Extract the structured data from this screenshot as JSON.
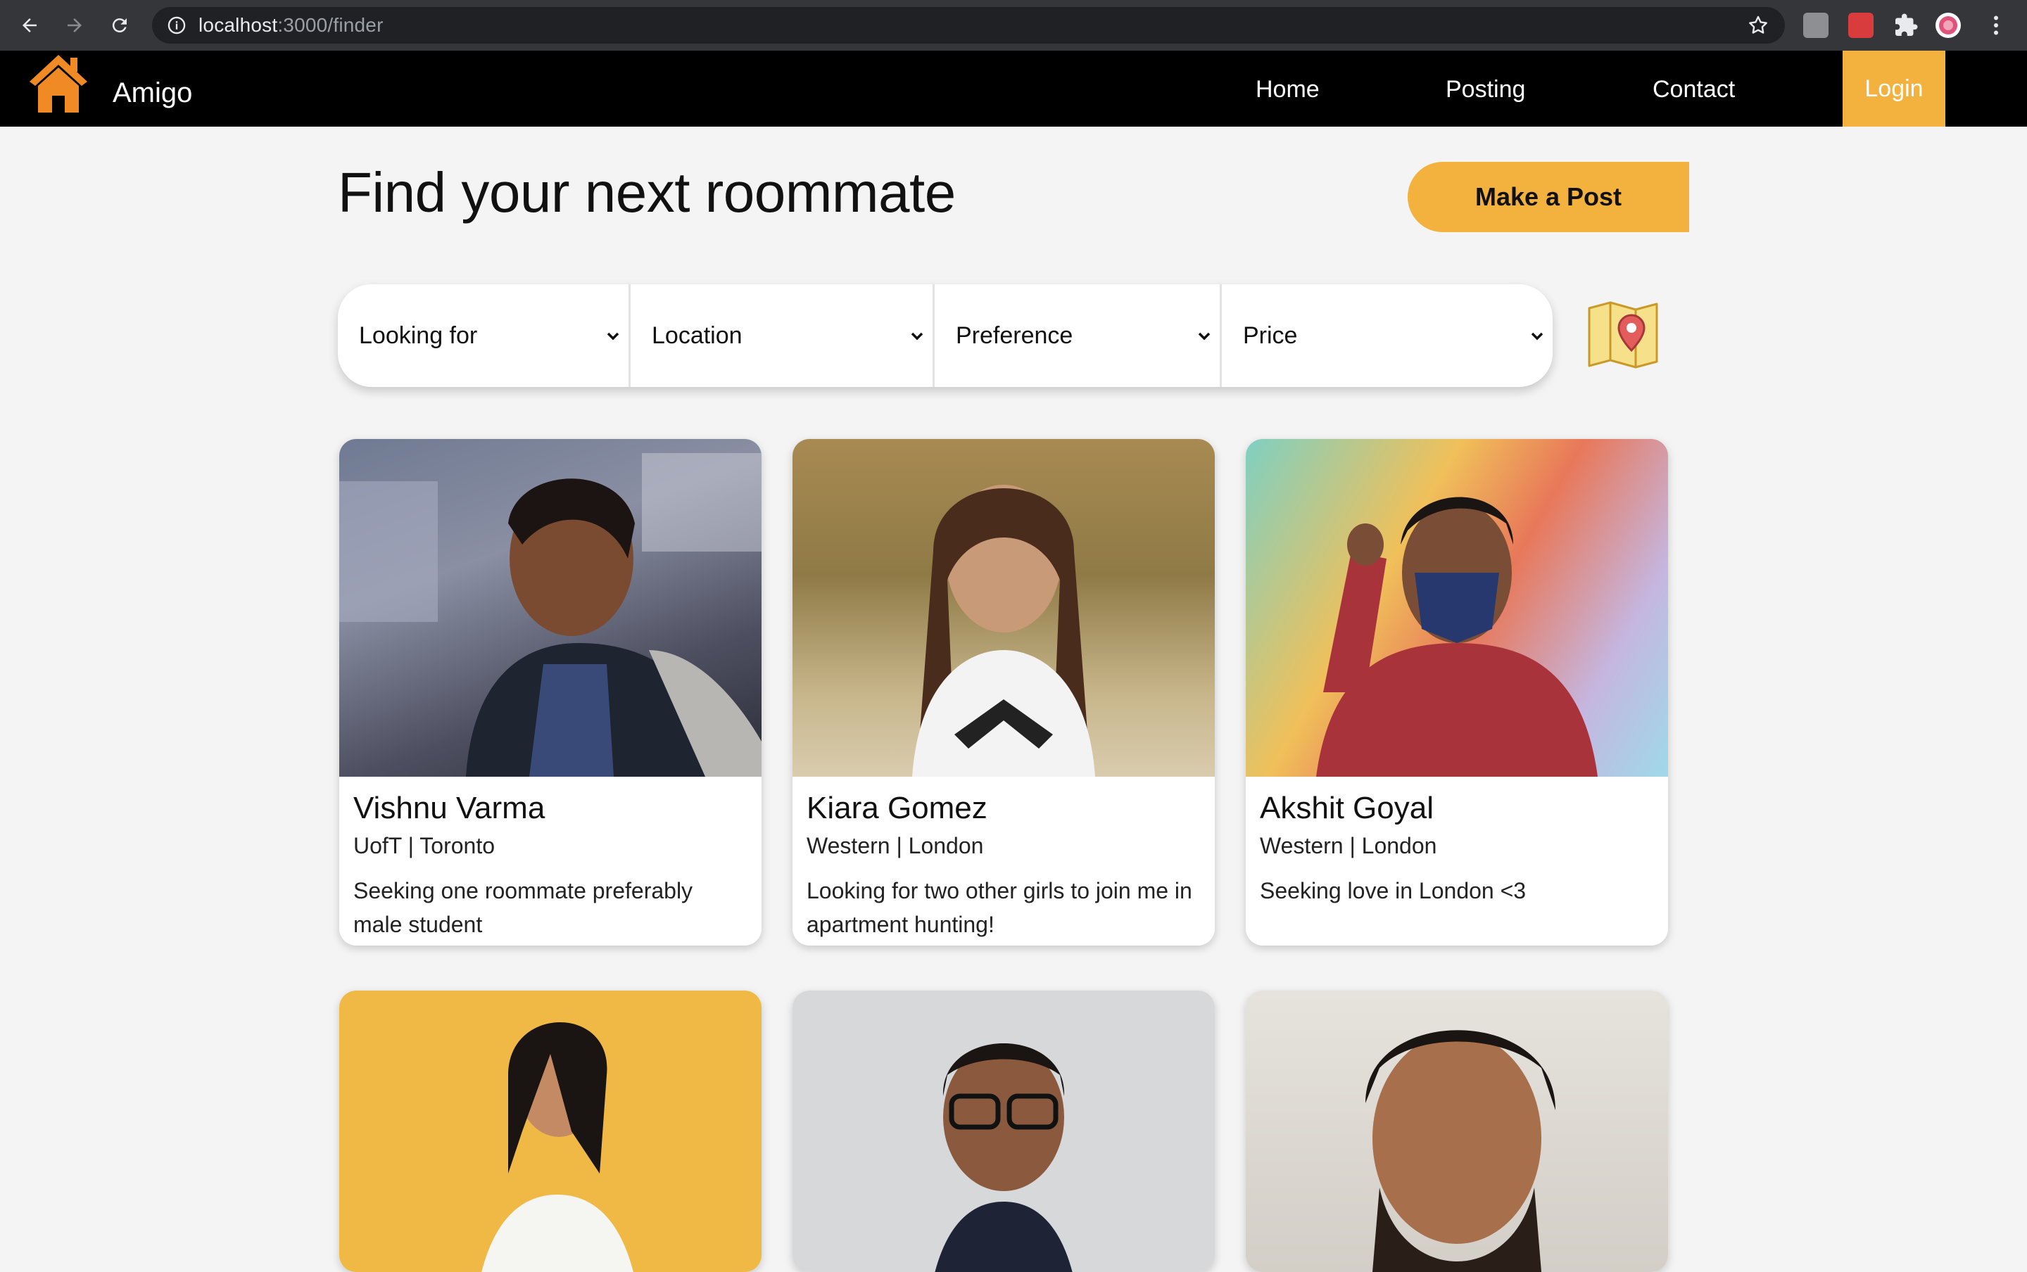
{
  "browser": {
    "url_host": "localhost",
    "url_path": ":3000/finder"
  },
  "nav": {
    "brand": "Amigo",
    "links": [
      "Home",
      "Posting",
      "Contact"
    ],
    "login": "Login"
  },
  "main": {
    "title": "Find your next roommate",
    "post_button": "Make a Post",
    "filters": [
      "Looking for",
      "Location",
      "Preference",
      "Price"
    ]
  },
  "cards": [
    {
      "name": "Vishnu Varma",
      "meta": "UofT | Toronto",
      "desc": "Seeking one roommate preferably male student"
    },
    {
      "name": "Kiara Gomez",
      "meta": "Western | London",
      "desc": "Looking for two other girls to join me in apartment hunting!"
    },
    {
      "name": "Akshit Goyal",
      "meta": "Western | London",
      "desc": "Seeking love in London <3"
    }
  ],
  "colors": {
    "accent": "#f3b13d",
    "nav_bg": "#000000",
    "page_bg": "#f4f4f4",
    "logo": "#f08a24"
  }
}
